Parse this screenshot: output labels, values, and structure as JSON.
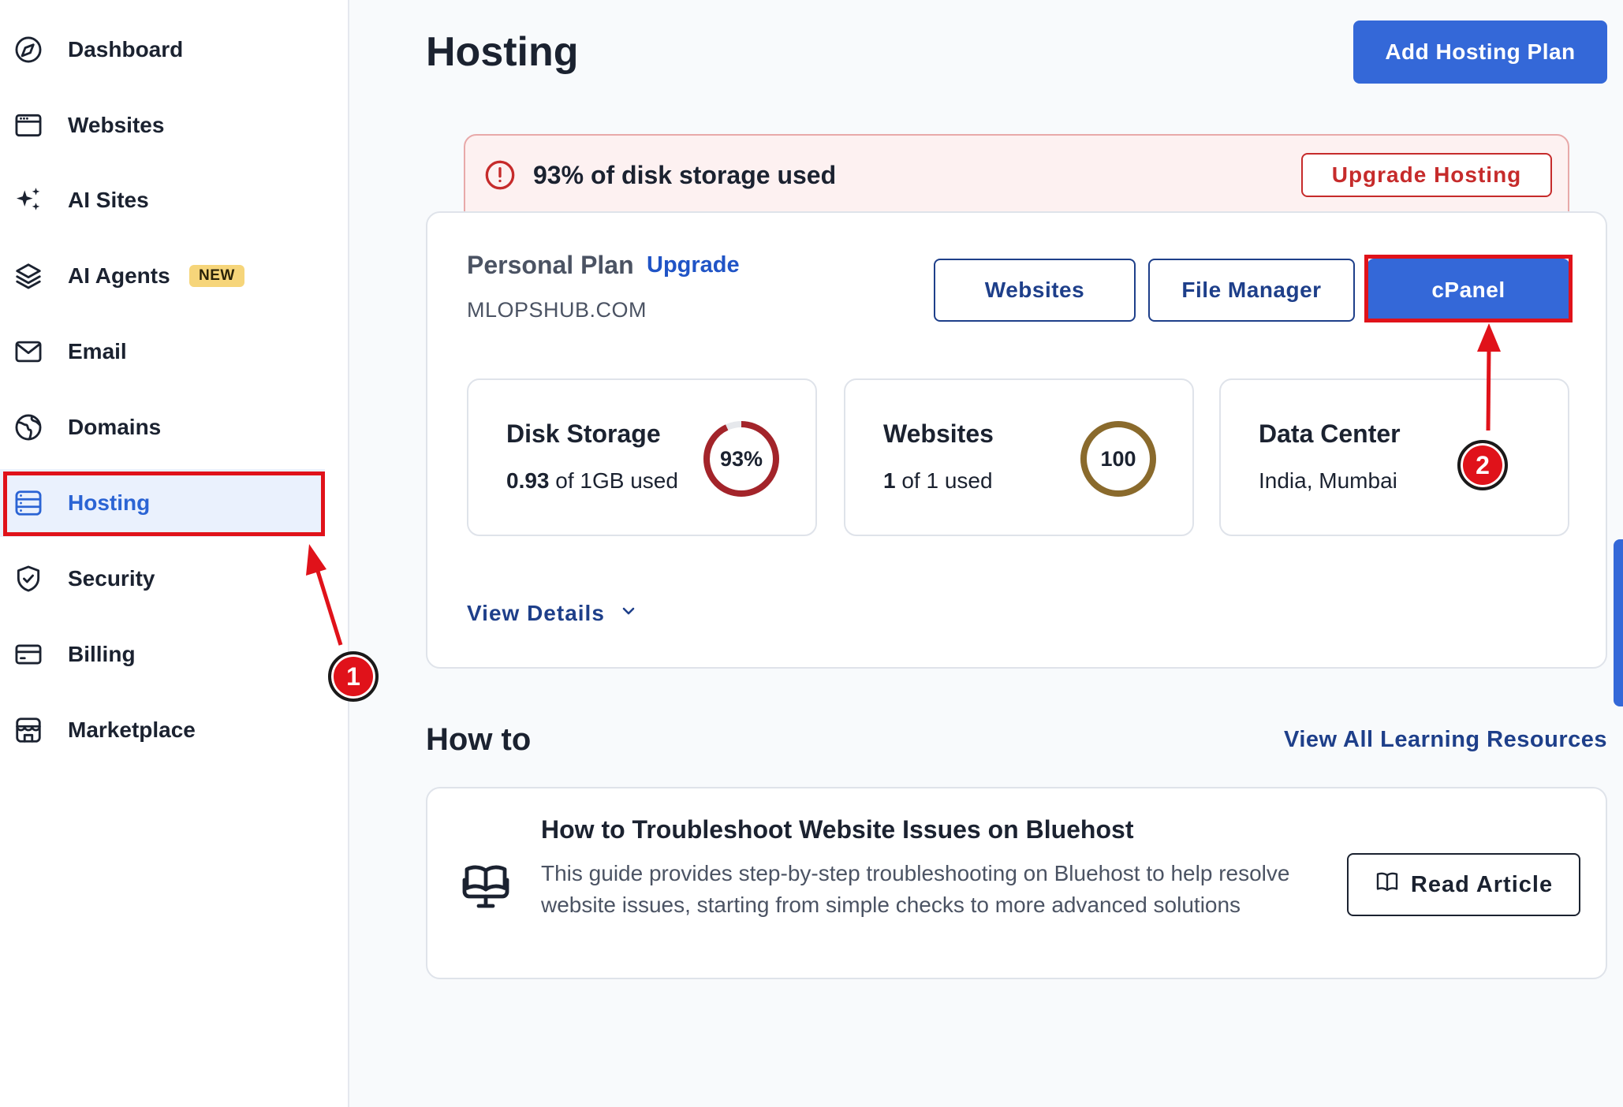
{
  "sidebar": {
    "items": [
      {
        "label": "Dashboard",
        "icon": "compass-icon"
      },
      {
        "label": "Websites",
        "icon": "browser-window-icon"
      },
      {
        "label": "AI Sites",
        "icon": "sparkles-icon"
      },
      {
        "label": "AI Agents",
        "icon": "layers-icon",
        "badge": "NEW"
      },
      {
        "label": "Email",
        "icon": "envelope-icon"
      },
      {
        "label": "Domains",
        "icon": "globe-icon"
      },
      {
        "label": "Hosting",
        "icon": "server-icon",
        "active": true
      },
      {
        "label": "Security",
        "icon": "shield-check-icon"
      },
      {
        "label": "Billing",
        "icon": "credit-card-icon"
      },
      {
        "label": "Marketplace",
        "icon": "storefront-icon"
      }
    ]
  },
  "header": {
    "title": "Hosting",
    "add_plan_label": "Add Hosting Plan"
  },
  "alert": {
    "message": "93% of disk storage used",
    "upgrade_label": "Upgrade Hosting",
    "icon": "exclamation-circle-icon"
  },
  "plan": {
    "name": "Personal Plan",
    "upgrade_label": "Upgrade",
    "domain": "MLOPSHUB.COM",
    "buttons": {
      "websites": "Websites",
      "file_manager": "File Manager",
      "cpanel": "cPanel"
    },
    "stats": {
      "disk": {
        "title": "Disk Storage",
        "used_value": "0.93",
        "used_suffix": " of 1GB used",
        "ring_label": "93%",
        "ring_fraction": 0.93,
        "ring_color": "#a3242a"
      },
      "websites": {
        "title": "Websites",
        "used_value": "1",
        "used_suffix": " of 1 used",
        "ring_label": "100",
        "ring_fraction": 1.0,
        "ring_color": "#8a6a2c"
      },
      "datacenter": {
        "title": "Data Center",
        "location": "India, Mumbai"
      }
    },
    "view_details_label": "View Details"
  },
  "howto": {
    "title": "How to",
    "view_all_label": "View All Learning Resources",
    "article": {
      "title": "How to Troubleshoot Website Issues on Bluehost",
      "description": "This guide provides step-by-step troubleshooting on Bluehost to help resolve website issues, starting from simple checks to more advanced solutions",
      "read_label": "Read Article"
    }
  },
  "annotations": {
    "step1": "1",
    "step2": "2",
    "color": "#e0121a"
  },
  "colors": {
    "primary": "#3468d8",
    "link": "#1e3f8a",
    "danger": "#c62b2b",
    "badge": "#f6d57a"
  }
}
